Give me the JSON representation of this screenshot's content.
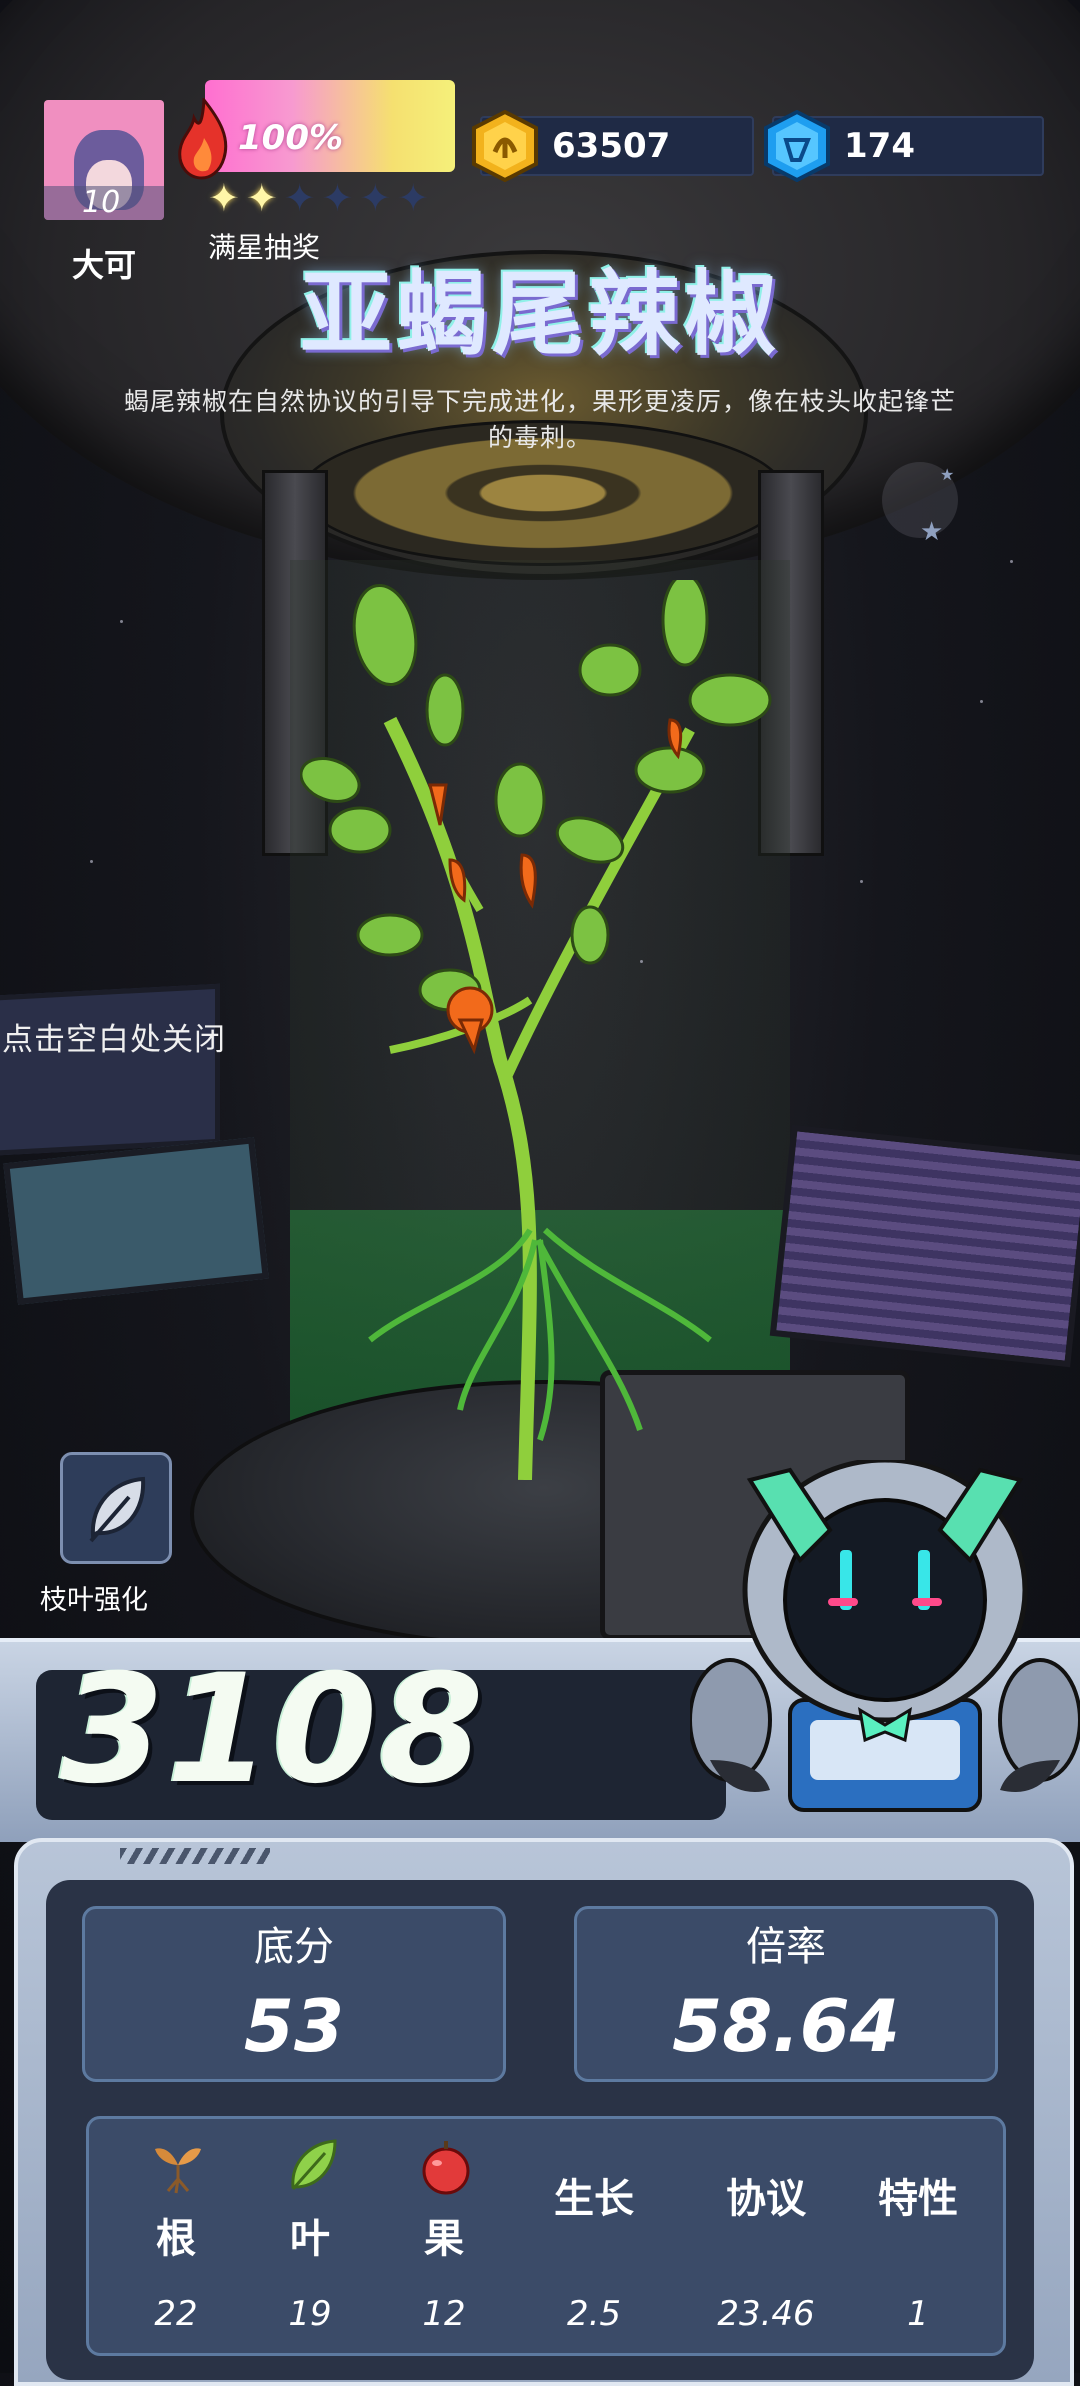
{
  "player": {
    "name": "大可",
    "level": "10"
  },
  "energy": {
    "percent_text": "100%",
    "stars_filled": 2,
    "stars_total": 6,
    "lottery_label": "满星抽奖"
  },
  "currency": {
    "coins": "63507",
    "gems": "174"
  },
  "plant": {
    "title": "亚蝎尾辣椒",
    "description_line1": "蝎尾辣椒在自然协议的引导下完成进化，果形更凌厉，像在枝头收起锋芒",
    "description_line2": "的毒刺。"
  },
  "hints": {
    "close": "点击空白处关闭"
  },
  "actions": {
    "leaf_enhance": "枝叶强化"
  },
  "score": {
    "total": "3108",
    "base_label": "底分",
    "base_value": "53",
    "multiplier_label": "倍率",
    "multiplier_value": "58.64"
  },
  "attributes": [
    {
      "label": "根",
      "value": "22",
      "icon": "sprout-icon"
    },
    {
      "label": "叶",
      "value": "19",
      "icon": "leaf-icon"
    },
    {
      "label": "果",
      "value": "12",
      "icon": "apple-icon"
    },
    {
      "label": "生长",
      "value": "2.5"
    },
    {
      "label": "协议",
      "value": "23.46"
    },
    {
      "label": "特性",
      "value": "1"
    }
  ],
  "colors": {
    "panel_bg": "#2a3346",
    "card_bg": "#3b4b68",
    "accent_pink": "#ff6fd0",
    "accent_yellow": "#f5f07a"
  }
}
